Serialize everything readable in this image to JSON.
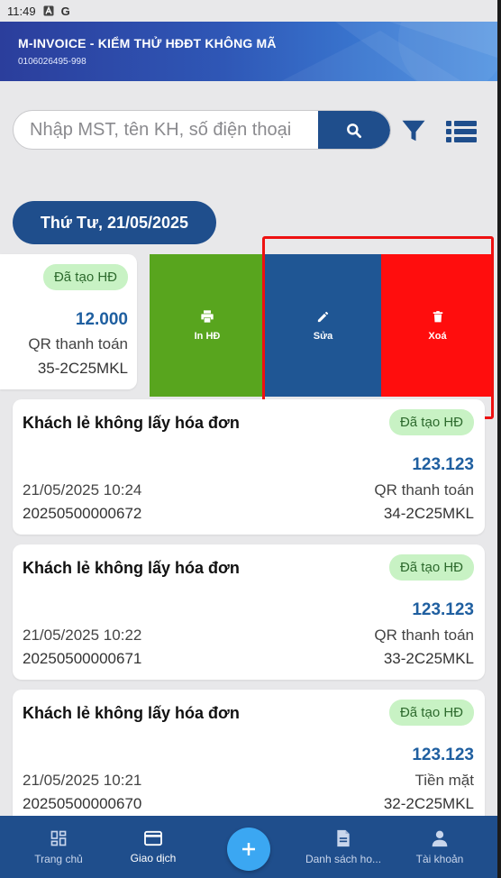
{
  "status_bar": {
    "time": "11:49",
    "icons": [
      "a-icon",
      "google-icon"
    ],
    "google_letter": "G"
  },
  "header": {
    "title": "M-INVOICE - KIỂM THỬ HĐĐT KHÔNG MÃ",
    "tax_code": "0106026495-998"
  },
  "search": {
    "placeholder": "Nhập MST, tên KH, số điện thoại",
    "value": ""
  },
  "date_filter": {
    "label": "Thứ Tư, 21/05/2025"
  },
  "swiped_card": {
    "badge": "Đã tạo HĐ",
    "amount": "12.000",
    "payment_method": "QR thanh toán",
    "code": "35-2C25MKL"
  },
  "swipe_actions": [
    {
      "label": "In HĐ",
      "icon": "print-icon",
      "color": "#58a51e"
    },
    {
      "label": "Sửa",
      "icon": "edit-icon",
      "color": "#1f5694"
    },
    {
      "label": "Xoá",
      "icon": "delete-icon",
      "color": "#ff0d0d"
    }
  ],
  "invoices": [
    {
      "customer": "Khách lẻ không lấy hóa đơn",
      "badge": "Đã tạo HĐ",
      "amount": "123.123",
      "datetime": "21/05/2025 10:24",
      "payment_method": "QR thanh toán",
      "invoice_number": "20250500000672",
      "code": "34-2C25MKL"
    },
    {
      "customer": "Khách lẻ không lấy hóa đơn",
      "badge": "Đã tạo HĐ",
      "amount": "123.123",
      "datetime": "21/05/2025 10:22",
      "payment_method": "QR thanh toán",
      "invoice_number": "20250500000671",
      "code": "33-2C25MKL"
    },
    {
      "customer": "Khách lẻ không lấy hóa đơn",
      "badge": "Đã tạo HĐ",
      "amount": "123.123",
      "datetime": "21/05/2025 10:21",
      "payment_method": "Tiền mặt",
      "invoice_number": "20250500000670",
      "code": "32-2C25MKL"
    }
  ],
  "bottom_nav": {
    "items": [
      {
        "label": "Trang chủ",
        "icon": "dashboard-icon"
      },
      {
        "label": "Giao dịch",
        "icon": "card-icon",
        "active": true
      },
      {
        "label": "Danh sách ho...",
        "icon": "document-icon"
      },
      {
        "label": "Tài khoản",
        "icon": "person-icon"
      }
    ],
    "fab_icon": "plus-icon"
  },
  "colors": {
    "primary": "#1f4e8c",
    "amount": "#1f5fa0",
    "badge_bg": "#c8f2c4",
    "badge_text": "#2d6a2d",
    "fab": "#3ba7f2",
    "highlight": "#ee1111"
  }
}
